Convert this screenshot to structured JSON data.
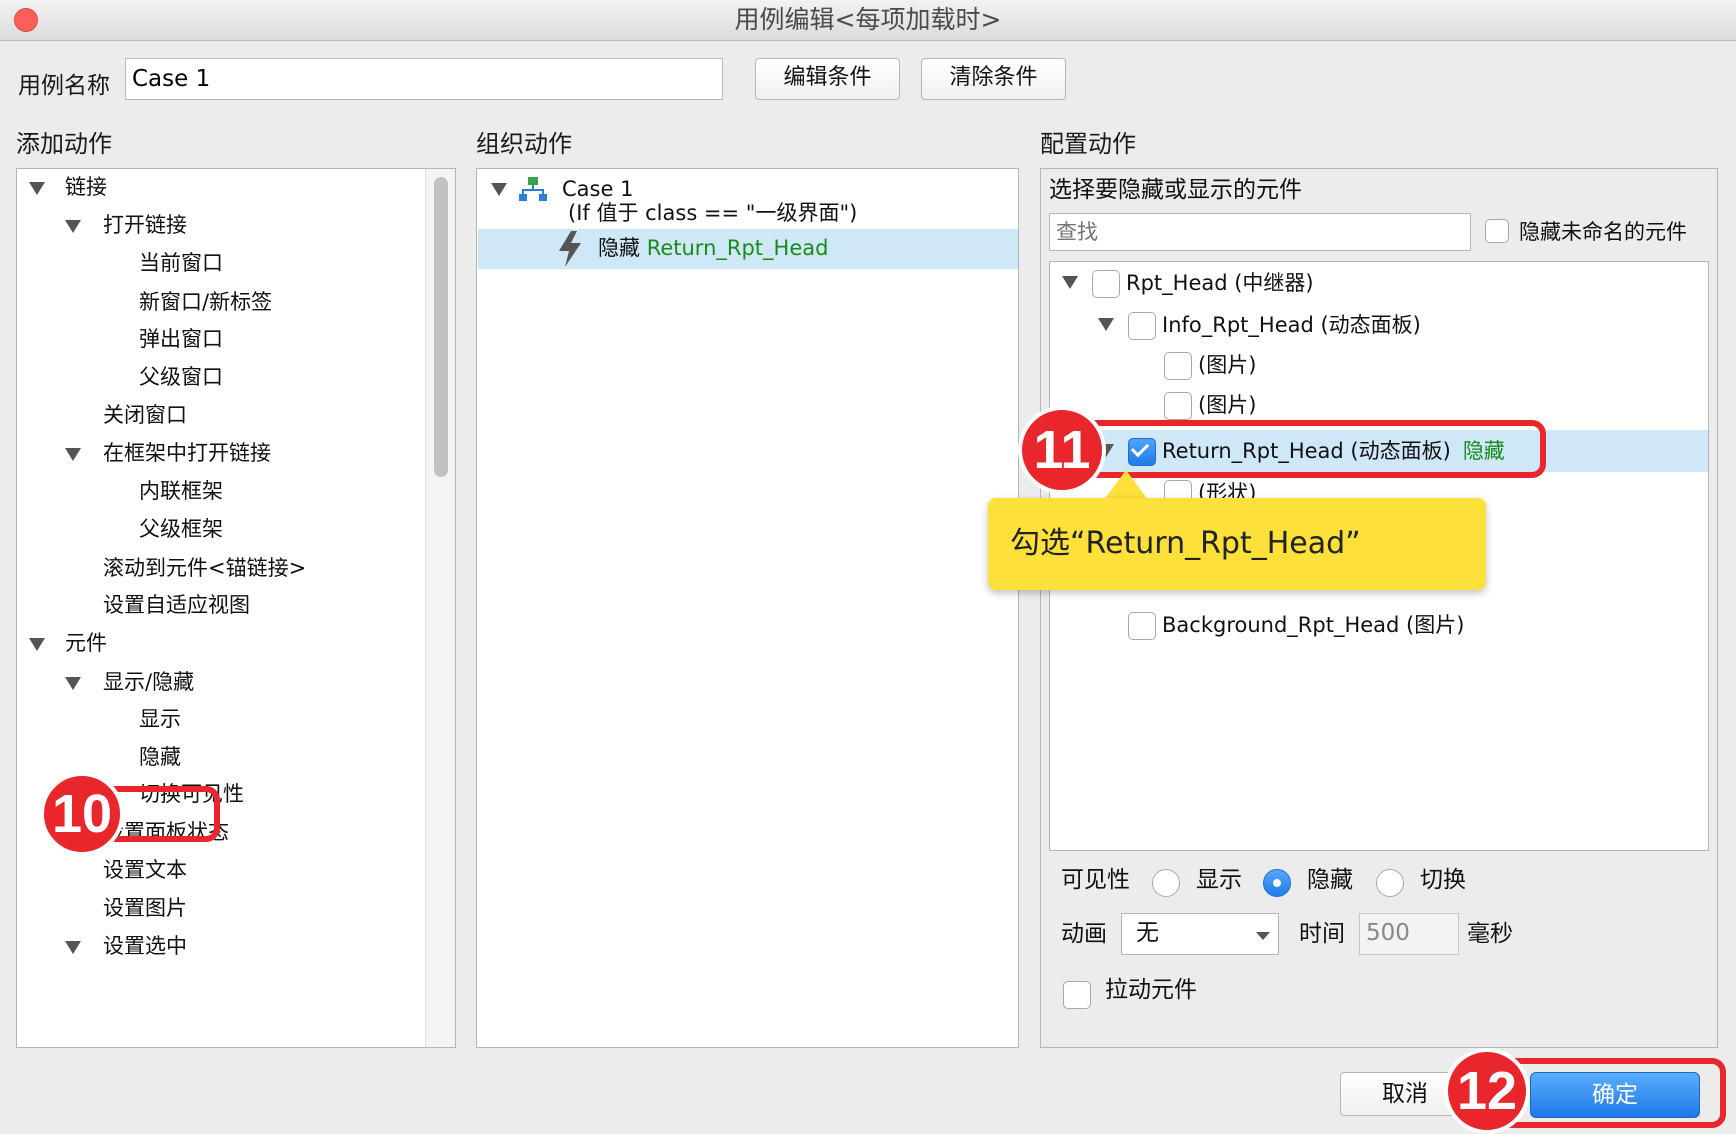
{
  "window": {
    "title": "用例编辑<每项加载时>"
  },
  "case_name": {
    "label": "用例名称",
    "value": "Case 1"
  },
  "buttons": {
    "edit_condition": "编辑条件",
    "clear_condition": "清除条件",
    "cancel": "取消",
    "ok": "确定"
  },
  "sections": {
    "add_action": "添加动作",
    "organize_action": "组织动作",
    "configure_action": "配置动作"
  },
  "add_action_tree": [
    {
      "label": "链接",
      "level": 0,
      "expander": true
    },
    {
      "label": "打开链接",
      "level": 1,
      "expander": true
    },
    {
      "label": "当前窗口",
      "level": 2
    },
    {
      "label": "新窗口/新标签",
      "level": 2
    },
    {
      "label": "弹出窗口",
      "level": 2
    },
    {
      "label": "父级窗口",
      "level": 2
    },
    {
      "label": "关闭窗口",
      "level": 1
    },
    {
      "label": "在框架中打开链接",
      "level": 1,
      "expander": true
    },
    {
      "label": "内联框架",
      "level": 2
    },
    {
      "label": "父级框架",
      "level": 2
    },
    {
      "label": "滚动到元件<锚链接>",
      "level": 1
    },
    {
      "label": "设置自适应视图",
      "level": 1
    },
    {
      "label": "元件",
      "level": 0,
      "expander": true
    },
    {
      "label": "显示/隐藏",
      "level": 1,
      "expander": true
    },
    {
      "label": "显示",
      "level": 2
    },
    {
      "label": "隐藏",
      "level": 2
    },
    {
      "label": "切换可见性",
      "level": 2
    },
    {
      "label": "设置面板状态",
      "level": 1
    },
    {
      "label": "设置文本",
      "level": 1
    },
    {
      "label": "设置图片",
      "level": 1
    },
    {
      "label": "设置选中",
      "level": 1,
      "expander": true
    }
  ],
  "organize": {
    "case_title": "Case 1",
    "condition": "(If 值于 class == \"一级界面\")",
    "action_verb": "隐藏",
    "action_target": "Return_Rpt_Head"
  },
  "configure": {
    "heading": "选择要隐藏或显示的元件",
    "search_placeholder": "查找",
    "hide_unnamed_label": "隐藏未命名的元件",
    "tree": [
      {
        "label": "Rpt_Head (中继器)",
        "checked": false
      },
      {
        "label": "Info_Rpt_Head (动态面板)",
        "checked": false
      },
      {
        "label": "(图片)",
        "checked": false
      },
      {
        "label": "(图片)",
        "checked": false
      },
      {
        "label": "Return_Rpt_Head (动态面板)",
        "checked": true,
        "state": "隐藏"
      },
      {
        "label": "(形状)",
        "checked": false
      },
      {
        "label": "Background_Rpt_Head (图片)",
        "checked": false
      }
    ],
    "visibility": {
      "label": "可见性",
      "options": [
        "显示",
        "隐藏",
        "切换"
      ],
      "selected": "隐藏"
    },
    "animation": {
      "label": "动画",
      "value": "无"
    },
    "time": {
      "label": "时间",
      "value": "500",
      "unit": "毫秒"
    },
    "drag_label": "拉动元件"
  },
  "annotations": {
    "step10": "10",
    "step11": "11",
    "step12": "12",
    "tooltip": "勾选“Return_Rpt_Head”"
  },
  "colors": {
    "accent": "#1f7bea",
    "annotation_red": "#e8262c",
    "tooltip_yellow": "#fde03a",
    "green_text": "#1a8a1a",
    "selection_blue": "#cfe8f7"
  }
}
